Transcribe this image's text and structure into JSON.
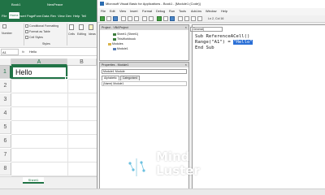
{
  "excel": {
    "title_left": "Book1",
    "title_right": "NewPeace",
    "tabs": [
      "File",
      "Home",
      "Insert",
      "Page",
      "Form",
      "Data",
      "Rev",
      "View",
      "Dev",
      "Help",
      "Tell"
    ],
    "active_tab": "Home",
    "ribbon": {
      "number": "Number",
      "conditional": "Conditional Formatting",
      "format_table": "Format as Table",
      "cell_styles": "Cell Styles",
      "styles": "Styles",
      "cells": "Cells",
      "editing": "Editing",
      "ideas": "Ideas"
    },
    "name_box": "A1",
    "fx": "fx",
    "formula_value": "Hello",
    "columns": [
      "A",
      "B"
    ],
    "rows": [
      "1",
      "2",
      "3",
      "4",
      "5",
      "6",
      "7",
      "8"
    ],
    "cell_a1": "Hello",
    "sheet_tab": "Sheet1"
  },
  "vbe": {
    "title": "Microsoft Visual Basic for Applications - Book1 - [Module1 (Code)]",
    "menu": [
      "File",
      "Edit",
      "View",
      "Insert",
      "Format",
      "Debug",
      "Run",
      "Tools",
      "Add-Ins",
      "Window",
      "Help"
    ],
    "cursor_pos": "Ln 2, Col 16",
    "project": {
      "title": "Project - VBAProject",
      "items": [
        "Sheet1 (Sheet1)",
        "ThisWorkbook",
        "Modules",
        "Module1"
      ]
    },
    "properties": {
      "title": "Properties - Module1",
      "select": "Module1 Module",
      "tabs": [
        "Alphabetic",
        "Categorized"
      ],
      "row": "(Name)  Module1"
    },
    "code": {
      "combo": "(General)",
      "line1": "Sub ReferenceACell()",
      "line2_prefix": "Range(\"A1\") = ",
      "line2_selected": "\"Hello\"",
      "line3": "End Sub"
    }
  },
  "watermark": {
    "line1": "Mind",
    "line2": "Luster"
  }
}
